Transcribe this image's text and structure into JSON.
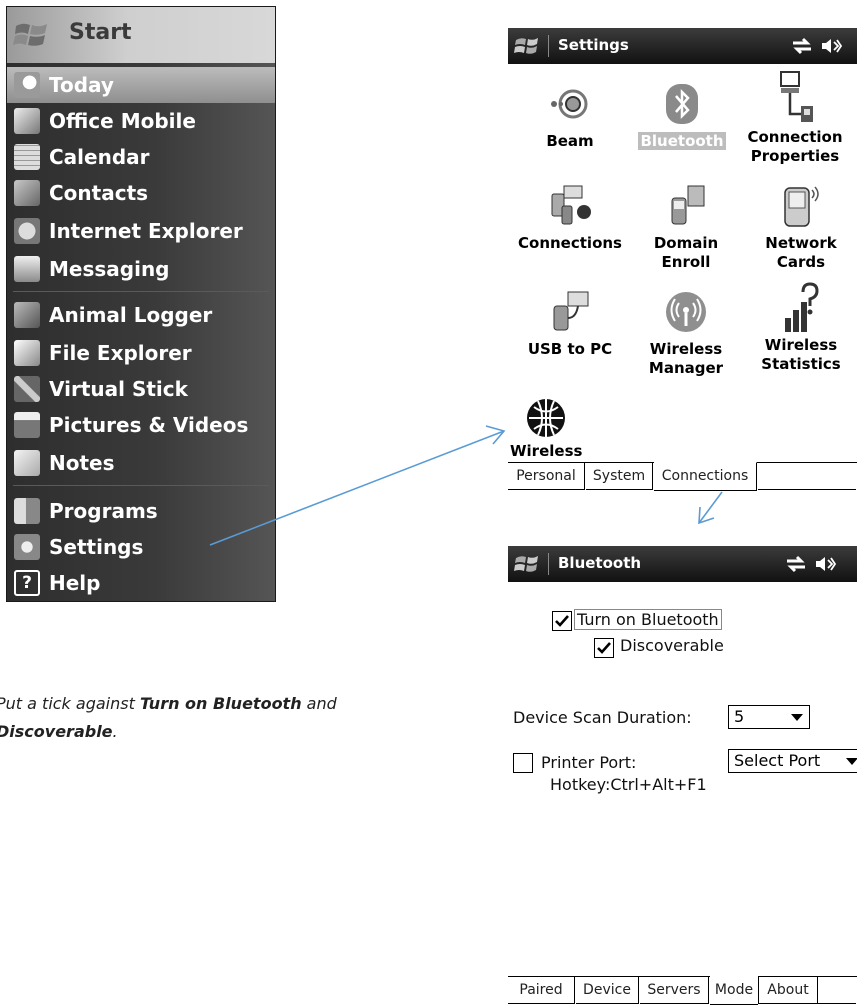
{
  "start_menu": {
    "title": "Start",
    "items": [
      {
        "label": "Today",
        "icon": "today-icon"
      },
      {
        "label": "Office Mobile",
        "icon": "office-mobile-icon"
      },
      {
        "label": "Calendar",
        "icon": "calendar-icon"
      },
      {
        "label": "Contacts",
        "icon": "contacts-icon"
      },
      {
        "label": "Internet Explorer",
        "icon": "internet-explorer-icon"
      },
      {
        "label": "Messaging",
        "icon": "messaging-icon"
      },
      {
        "label": "Animal Logger",
        "icon": "animal-logger-icon"
      },
      {
        "label": "File Explorer",
        "icon": "file-explorer-icon"
      },
      {
        "label": "Virtual Stick",
        "icon": "virtual-stick-icon"
      },
      {
        "label": "Pictures & Videos",
        "icon": "pictures-videos-icon"
      },
      {
        "label": "Notes",
        "icon": "notes-icon"
      },
      {
        "label": "Programs",
        "icon": "programs-icon"
      },
      {
        "label": "Settings",
        "icon": "settings-icon"
      },
      {
        "label": "Help",
        "icon": "help-icon"
      }
    ],
    "help_glyph": "?"
  },
  "settings_window": {
    "title": "Settings",
    "tiles": [
      {
        "label": "Beam",
        "icon": "beam-icon"
      },
      {
        "label": "Bluetooth",
        "icon": "bluetooth-icon"
      },
      {
        "label": "Connection Properties",
        "icon": "connection-properties-icon"
      },
      {
        "label": "Connections",
        "icon": "connections-icon"
      },
      {
        "label": "Domain Enroll",
        "icon": "domain-enroll-icon"
      },
      {
        "label": "Network Cards",
        "icon": "network-cards-icon"
      },
      {
        "label": "USB to PC",
        "icon": "usb-to-pc-icon"
      },
      {
        "label": "Wireless Manager",
        "icon": "wireless-manager-icon"
      },
      {
        "label": "Wireless Statistics",
        "icon": "wireless-statistics-icon"
      },
      {
        "label": "Wireless",
        "icon": "wireless-icon"
      }
    ],
    "tabs": [
      "Personal",
      "System",
      "Connections"
    ],
    "active_tab": "Connections"
  },
  "bluetooth_window": {
    "title": "Bluetooth",
    "turn_on_label": "Turn on Bluetooth",
    "turn_on_checked": true,
    "discoverable_label": "Discoverable",
    "discoverable_checked": true,
    "scan_duration_label": "Device Scan Duration:",
    "scan_duration_value": "5",
    "printer_port_label": "Printer Port:",
    "printer_port_checked": false,
    "printer_port_value": "Select Port",
    "hotkey_text": "Hotkey:Ctrl+Alt+F1",
    "tabs": [
      "Paired",
      "Device",
      "Servers",
      "Mode",
      "About"
    ],
    "active_tab": "Mode"
  },
  "instruction": {
    "prefix": "Put a tick against ",
    "bold1": "Turn on Bluetooth",
    "middle": " and",
    "bold2": "Discoverable",
    "suffix": "."
  },
  "colors": {
    "arrow": "#5b9bd5",
    "menu_bg": "#2e2e2e",
    "titlebar": "#1e1e1e"
  }
}
